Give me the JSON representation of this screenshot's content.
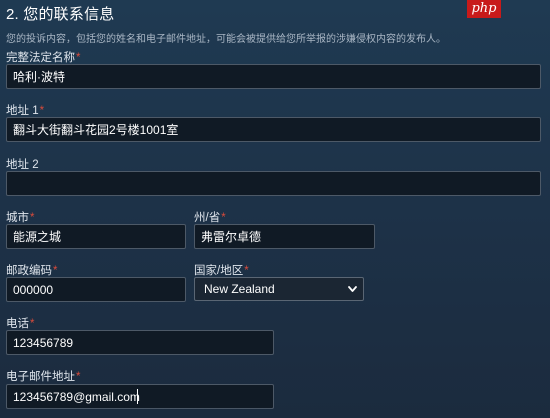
{
  "badge": "php",
  "section": {
    "title": "2. 您的联系信息",
    "description": "您的投诉内容，包括您的姓名和电子邮件地址，可能会被提供给您所举报的涉嫌侵权内容的发布人。"
  },
  "required_mark": "*",
  "fields": {
    "full_name": {
      "label": "完整法定名称",
      "value": "哈利·波特",
      "required": true
    },
    "address1": {
      "label": "地址 1",
      "value": "翻斗大街翻斗花园2号楼1001室",
      "required": true
    },
    "address2": {
      "label": "地址 2",
      "value": "",
      "required": false
    },
    "city": {
      "label": "城市",
      "value": "能源之城",
      "required": true
    },
    "state": {
      "label": "州/省",
      "value": "弗雷尔卓德",
      "required": true
    },
    "postal_code": {
      "label": "邮政编码",
      "value": "000000",
      "required": true
    },
    "country": {
      "label": "国家/地区",
      "value": "New Zealand",
      "required": true
    },
    "phone": {
      "label": "电话",
      "value": "123456789",
      "required": true
    },
    "email": {
      "label": "电子邮件地址",
      "value": "123456789@gmail.com",
      "required": true
    }
  },
  "colors": {
    "background": "#1d3147",
    "input_bg": "#101a25",
    "input_border": "#4d5967",
    "required": "#d94b3b",
    "badge_bg": "#c81a1a"
  }
}
